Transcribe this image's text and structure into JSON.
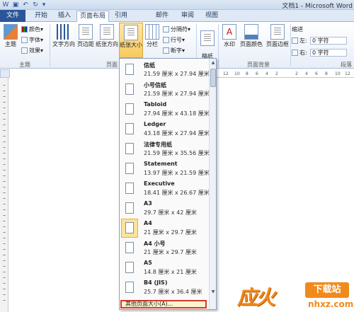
{
  "title_bar": {
    "document_title": "文档1 - Microsoft Word",
    "quick_access": [
      "save-icon",
      "undo-icon",
      "redo-icon",
      "customize-icon"
    ]
  },
  "tabs": [
    "文件",
    "开始",
    "插入",
    "页面布局",
    "引用",
    "邮件",
    "审阅",
    "视图"
  ],
  "ribbon": {
    "theme_group": {
      "themes": "主题",
      "colors": "颜色",
      "fonts": "字体",
      "effects": "效果",
      "label": "主题"
    },
    "page_setup": {
      "text_direction": "文字方向",
      "margins": "页边距",
      "orientation": "纸张方向",
      "size": "纸张大小",
      "columns": "分栏",
      "breaks": "分隔符",
      "line_numbers": "行号",
      "hyphenation": "断字",
      "label_partial": "页面"
    },
    "manuscript": "稿纸\n设置",
    "page_background": {
      "watermark": "水印",
      "page_color": "页面颜色",
      "page_borders": "页面边框",
      "label": "页面背景"
    },
    "indent": {
      "title": "缩进",
      "left_label": "左:",
      "left_value": "0 字符",
      "right_label": "右:",
      "right_value": "0 字符"
    },
    "paragraph_label": "段落"
  },
  "ruler": {
    "marks": [
      "12",
      "10",
      "8",
      "6",
      "4",
      "2",
      "",
      "2",
      "4",
      "6",
      "8",
      "10",
      "12"
    ]
  },
  "paper_sizes": [
    {
      "name": "信纸",
      "dims": "21.59 厘米 x 27.94 厘米",
      "selected": false
    },
    {
      "name": "小号信纸",
      "dims": "21.59 厘米 x 27.94 厘米",
      "selected": false
    },
    {
      "name": "Tabloid",
      "dims": "27.94 厘米 x 43.18 厘米",
      "selected": false
    },
    {
      "name": "Ledger",
      "dims": "43.18 厘米 x 27.94 厘米",
      "selected": false
    },
    {
      "name": "法律专用纸",
      "dims": "21.59 厘米 x 35.56 厘米",
      "selected": false
    },
    {
      "name": "Statement",
      "dims": "13.97 厘米 x 21.59 厘米",
      "selected": false
    },
    {
      "name": "Executive",
      "dims": "18.41 厘米 x 26.67 厘米",
      "selected": false
    },
    {
      "name": "A3",
      "dims": "29.7 厘米 x 42 厘米",
      "selected": false
    },
    {
      "name": "A4",
      "dims": "21 厘米 x 29.7 厘米",
      "selected": true
    },
    {
      "name": "A4 小号",
      "dims": "21 厘米 x 29.7 厘米",
      "selected": false
    },
    {
      "name": "A5",
      "dims": "14.8 厘米 x 21 厘米",
      "selected": false
    },
    {
      "name": "B4 (JIS)",
      "dims": "25.7 厘米 x 36.4 厘米",
      "selected": false
    }
  ],
  "more_sizes": "其他页面大小(A)...",
  "watermark": {
    "logo": "应火",
    "badge": "下载站",
    "domain": "nhxz.com"
  }
}
